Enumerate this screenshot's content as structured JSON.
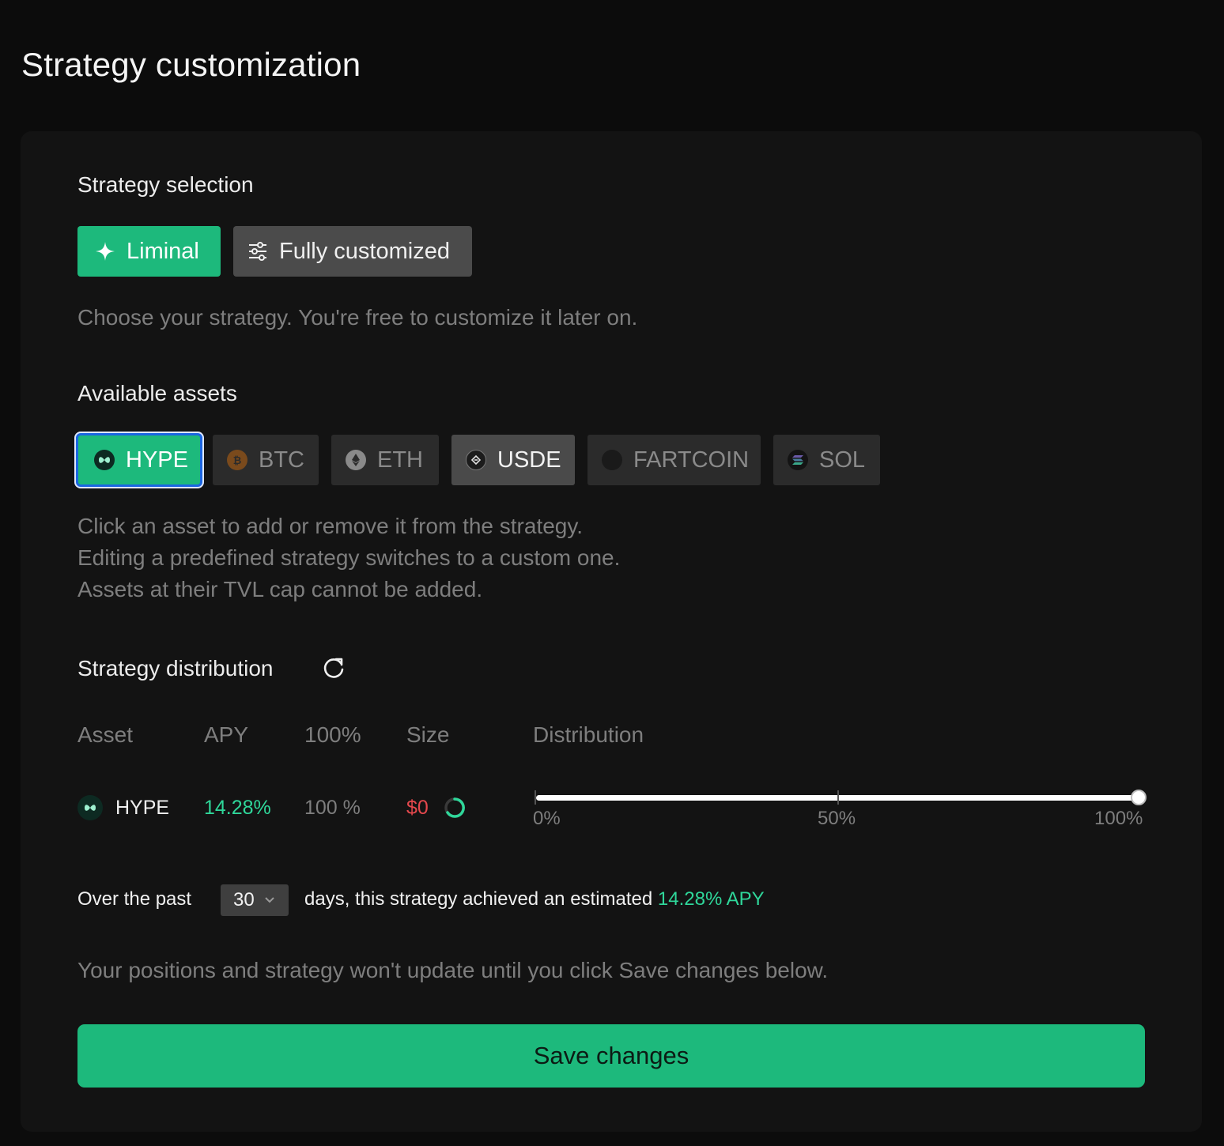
{
  "page": {
    "title": "Strategy customization"
  },
  "strategy_selection": {
    "label": "Strategy selection",
    "options": [
      {
        "label": "Liminal",
        "selected": true,
        "icon": "sparkle-icon"
      },
      {
        "label": "Fully customized",
        "selected": false,
        "icon": "sliders-icon"
      }
    ],
    "help": "Choose your strategy. You're free to customize it later on."
  },
  "assets": {
    "label": "Available assets",
    "items": [
      {
        "label": "HYPE",
        "state": "selected",
        "icon": "hype-icon"
      },
      {
        "label": "BTC",
        "state": "disabled",
        "icon": "btc-icon"
      },
      {
        "label": "ETH",
        "state": "disabled",
        "icon": "eth-icon"
      },
      {
        "label": "USDE",
        "state": "available",
        "icon": "usde-icon"
      },
      {
        "label": "FARTCOIN",
        "state": "disabled",
        "icon": "fartcoin-icon"
      },
      {
        "label": "SOL",
        "state": "disabled",
        "icon": "sol-icon"
      }
    ],
    "help_lines": [
      "Click an asset to add or remove it from the strategy.",
      "Editing a predefined strategy switches to a custom one.",
      "Assets at their TVL cap cannot be added."
    ]
  },
  "distribution": {
    "label": "Strategy distribution",
    "reset_icon": "refresh-icon",
    "columns": [
      "Asset",
      "APY",
      "100%",
      "Size",
      "Distribution"
    ],
    "rows": [
      {
        "asset": "HYPE",
        "apy": "14.28%",
        "percent": "100 %",
        "size": "$0",
        "distribution": 1.0
      }
    ],
    "scale_labels": [
      "0%",
      "50%",
      "100%"
    ]
  },
  "summary": {
    "prefix": "Over the past",
    "days": "30",
    "middle": "days, this strategy achieved an estimated",
    "apy": "14.28% APY"
  },
  "notice": "Your positions and strategy won't update until you click Save changes below.",
  "save_label": "Save changes",
  "colors": {
    "accent": "#1db97c",
    "negative": "#e5484d",
    "panel": "#131313",
    "background": "#0c0c0c"
  }
}
